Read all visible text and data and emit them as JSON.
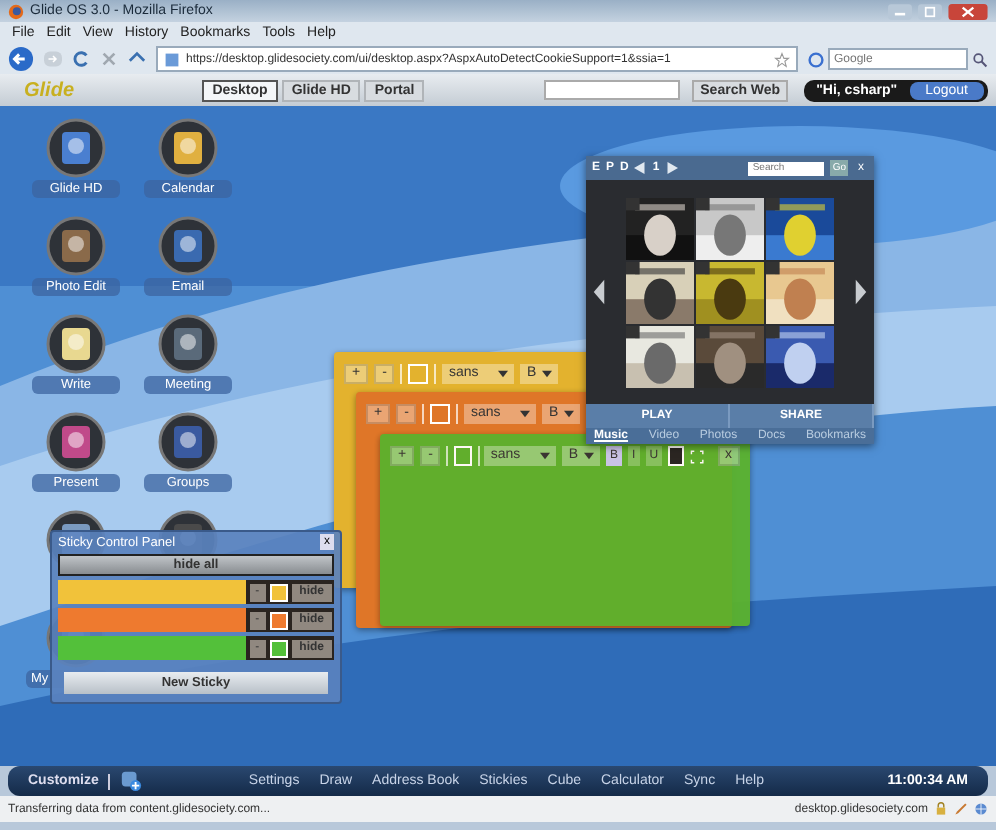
{
  "window": {
    "title": "Glide OS 3.0 - Mozilla Firefox"
  },
  "menu": [
    "File",
    "Edit",
    "View",
    "History",
    "Bookmarks",
    "Tools",
    "Help"
  ],
  "address_bar": {
    "url": "https://desktop.glidesociety.com/ui/desktop.aspx?AspxAutoDetectCookieSupport=1&ssia=1"
  },
  "browser_search": {
    "placeholder": "Google"
  },
  "header": {
    "logo": "Glide",
    "tabs": [
      {
        "label": "Desktop",
        "selected": true
      },
      {
        "label": "Glide HD",
        "selected": false
      },
      {
        "label": "Portal",
        "selected": false
      }
    ],
    "search_button": "Search Web",
    "greeting": "\"Hi, csharp\"",
    "logout": "Logout"
  },
  "desktop_icons": [
    {
      "kind": "app",
      "label": "Glide HD"
    },
    {
      "kind": "app",
      "label": "Calendar"
    },
    {
      "kind": "app",
      "label": "Photo Edit"
    },
    {
      "kind": "app",
      "label": "Email"
    },
    {
      "kind": "app",
      "label": "Write"
    },
    {
      "kind": "app",
      "label": "Meeting"
    },
    {
      "kind": "app",
      "label": "Present"
    },
    {
      "kind": "app",
      "label": "Groups"
    },
    {
      "kind": "icon"
    },
    {
      "kind": "icon"
    },
    {
      "kind": "partial",
      "label": "My"
    }
  ],
  "stickies": [
    {
      "color": "#e3b22e",
      "buttons": [
        "+",
        "-"
      ],
      "font": "sans",
      "size": "B"
    },
    {
      "color": "#df7628",
      "buttons": [
        "+",
        "-"
      ],
      "font": "sans",
      "size": "B"
    },
    {
      "color": "#5bb22d",
      "buttons": [
        "+",
        "-"
      ],
      "font": "sans",
      "size": "B",
      "format": [
        "B",
        "I",
        "U"
      ],
      "close": "x"
    }
  ],
  "media": {
    "letters": [
      "E",
      "P",
      "D"
    ],
    "page": "1",
    "search": {
      "placeholder": "Search"
    },
    "go": "Go",
    "close": "x",
    "albums": [
      {
        "kind": "picture"
      },
      {
        "kind": "picture"
      },
      {
        "kind": "picture"
      },
      {
        "kind": "picture"
      },
      {
        "kind": "picture"
      },
      {
        "kind": "picture"
      },
      {
        "kind": "picture"
      },
      {
        "kind": "picture"
      },
      {
        "kind": "picture"
      }
    ],
    "buttons": [
      "PLAY",
      "SHARE"
    ],
    "tabs": [
      {
        "label": "Music",
        "selected": true
      },
      {
        "label": "Video",
        "selected": false
      },
      {
        "label": "Photos",
        "selected": false
      },
      {
        "label": "Docs",
        "selected": false
      },
      {
        "label": "Bookmarks",
        "selected": false
      }
    ]
  },
  "sticky_panel": {
    "title": "Sticky Control Panel",
    "close": "x",
    "hide_all": "hide all",
    "rows": [
      {
        "color": "#f1c23a",
        "minus": "-",
        "hide": "hide"
      },
      {
        "color": "#ee7a2f",
        "minus": "-",
        "hide": "hide"
      },
      {
        "color": "#53c03a",
        "minus": "-",
        "hide": "hide"
      }
    ],
    "new_button": "New Sticky"
  },
  "taskbar": {
    "customize": "Customize",
    "items": [
      "Settings",
      "Draw",
      "Address Book",
      "Stickies",
      "Cube",
      "Calculator",
      "Sync",
      "Help"
    ],
    "clock": "11:00:34 AM"
  },
  "status_bar": {
    "text": "Transferring data from content.glidesociety.com...",
    "host": "desktop.glidesociety.com"
  }
}
